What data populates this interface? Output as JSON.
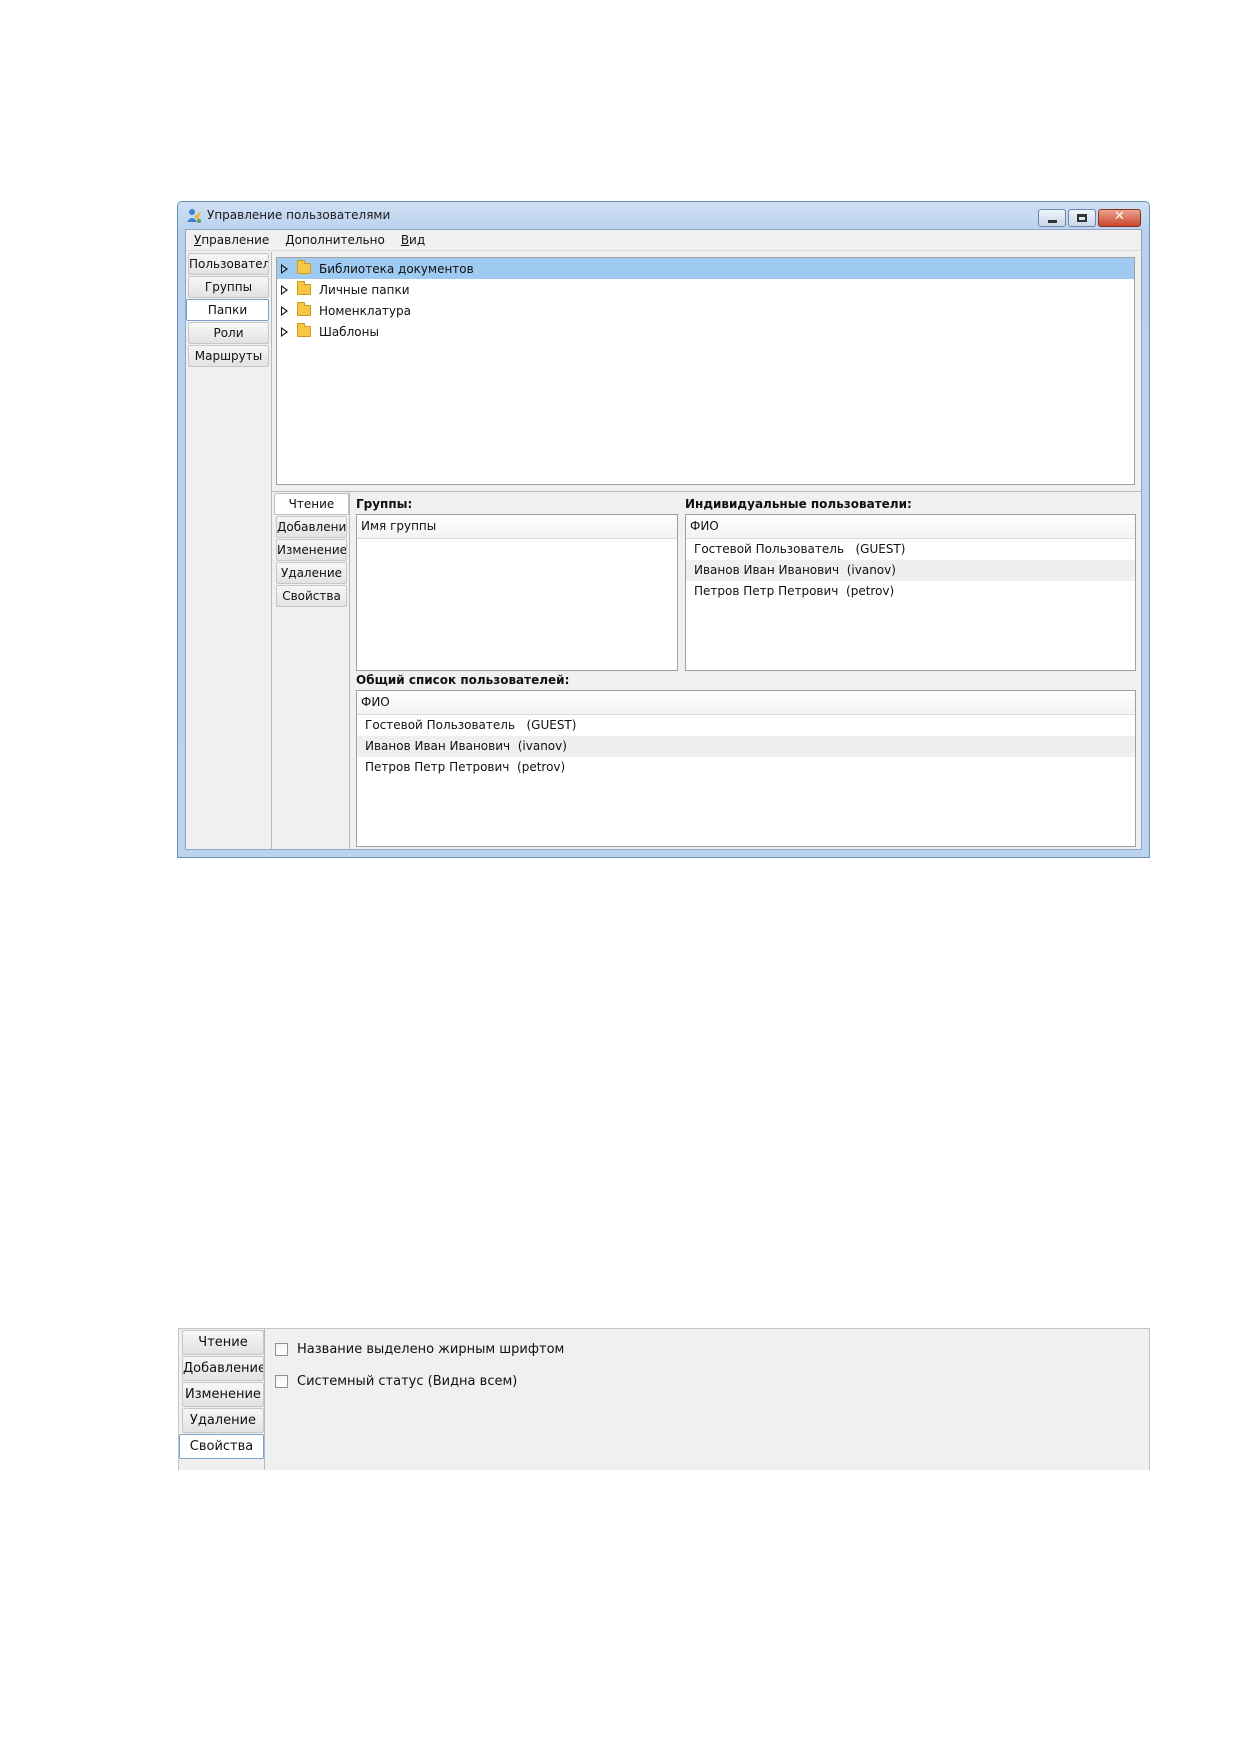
{
  "window": {
    "title": "Управление пользователями",
    "menu": [
      {
        "underline": "У",
        "rest": "правление"
      },
      {
        "underline": "Д",
        "rest": "ополнительно"
      },
      {
        "underline": "В",
        "rest": "ид"
      }
    ],
    "side_tabs": [
      "Пользователи",
      "Группы",
      "Папки",
      "Роли",
      "Маршруты"
    ],
    "side_tabs_active": "Папки",
    "tree": [
      {
        "label": "Библиотека документов",
        "selected": true
      },
      {
        "label": "Личные папки",
        "selected": false
      },
      {
        "label": "Номенклатура",
        "selected": false
      },
      {
        "label": "Шаблоны",
        "selected": false
      }
    ],
    "perm_tabs": [
      "Чтение",
      "Добавление",
      "Изменение",
      "Удаление",
      "Свойства"
    ],
    "perm_tabs_active": "Чтение",
    "groups": {
      "label": "Группы:",
      "column": "Имя группы",
      "rows": []
    },
    "individual_users": {
      "label": "Индивидуальные пользователи:",
      "column": "ФИО",
      "rows": [
        "Гостевой Пользователь   (GUEST)",
        "Иванов Иван Иванович  (ivanov)",
        "Петров Петр Петрович  (petrov)"
      ]
    },
    "all_users": {
      "label": "Общий список пользователей:",
      "column": "ФИО",
      "rows": [
        "Гостевой Пользователь   (GUEST)",
        "Иванов Иван Иванович  (ivanov)",
        "Петров Петр Петрович  (petrov)"
      ]
    }
  },
  "properties_panel": {
    "tabs": [
      "Чтение",
      "Добавление",
      "Изменение",
      "Удаление",
      "Свойства"
    ],
    "active_tab": "Свойства",
    "checkboxes": [
      {
        "label": "Название выделено жирным шрифтом",
        "checked": false
      },
      {
        "label": "Системный статус (Видна всем)",
        "checked": false
      }
    ]
  }
}
